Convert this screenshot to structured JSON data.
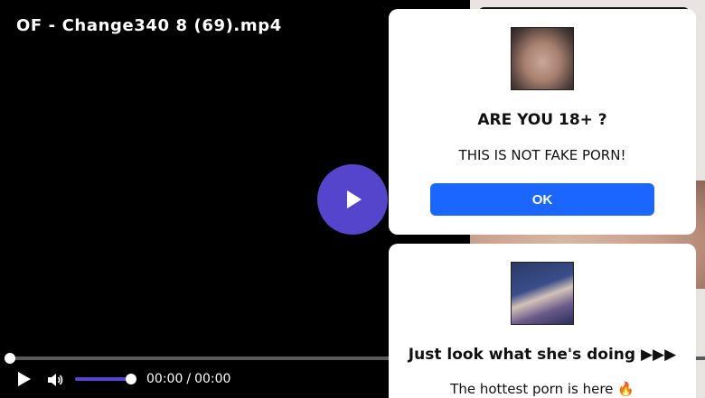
{
  "video": {
    "title": "OF - Change340 8 (69).mp4",
    "current_time": "00:00",
    "time_separator": "/",
    "duration": "00:00",
    "progress": 0,
    "volume": 1.0
  },
  "colors": {
    "accent": "#5544cc",
    "ok_button": "#1a66ff"
  },
  "popup_age": {
    "title": "ARE YOU 18+ ?",
    "text": "THIS IS NOT FAKE PORN!",
    "button_label": "OK"
  },
  "popup_promo": {
    "title": "Just look what she's doing ▶▶▶",
    "text": "The hottest porn is here 🔥"
  },
  "icons": [
    "play-icon",
    "volume-icon"
  ]
}
